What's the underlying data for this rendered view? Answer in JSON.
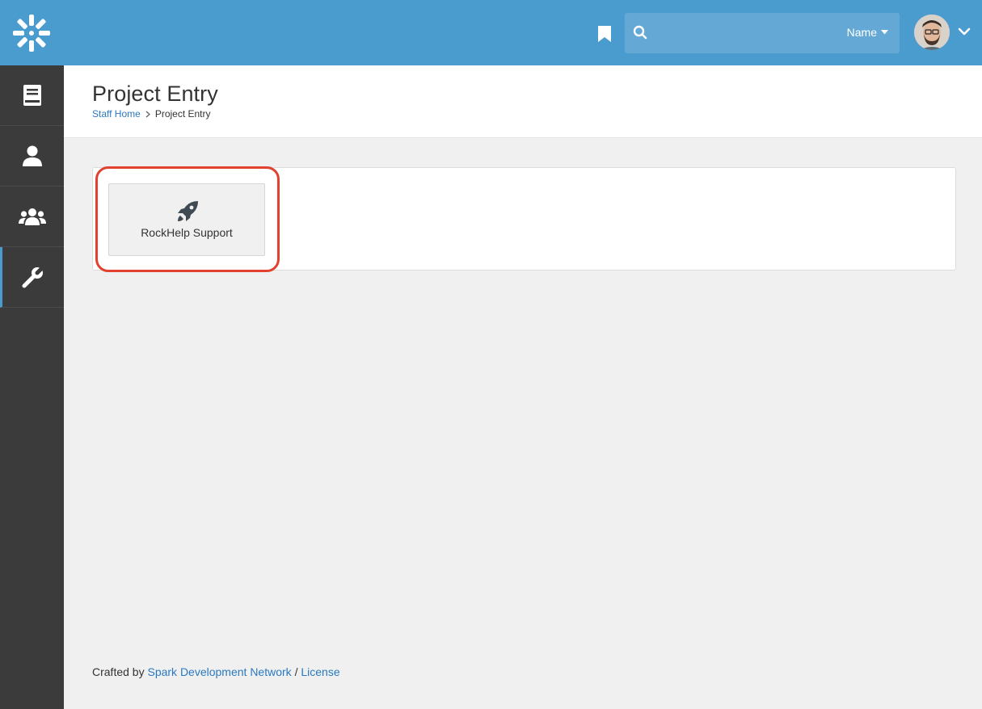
{
  "header": {
    "search": {
      "placeholder": "",
      "filter_label": "Name"
    },
    "colors": {
      "brand": "#4a9ccf",
      "sidebar": "#3b3b3b",
      "accent_link": "#2a79bf",
      "highlight": "#e1412e"
    }
  },
  "sidebar": {
    "items": [
      {
        "icon": "book-icon"
      },
      {
        "icon": "person-icon"
      },
      {
        "icon": "group-icon"
      },
      {
        "icon": "wrench-icon",
        "active": true
      }
    ]
  },
  "page": {
    "title": "Project Entry",
    "breadcrumb": [
      {
        "label": "Staff Home",
        "link": true
      },
      {
        "label": "Project Entry",
        "link": false
      }
    ]
  },
  "tiles": [
    {
      "icon": "rocket-icon",
      "label": "RockHelp Support"
    }
  ],
  "footer": {
    "prefix": "Crafted by",
    "link1": "Spark Development Network",
    "separator": "/",
    "link2": "License"
  }
}
